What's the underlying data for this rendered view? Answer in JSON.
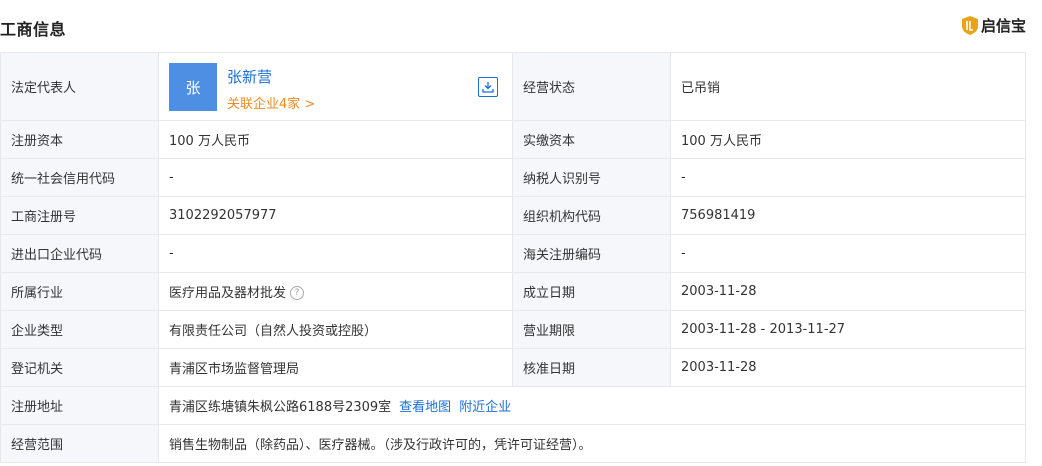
{
  "header": {
    "title": "工商信息",
    "brand": "启信宝",
    "brand_color": "#e8a317"
  },
  "representative": {
    "label": "法定代表人",
    "avatar_char": "张",
    "name": "张新营",
    "related": "关联企业4家 >",
    "download_icon": "download-icon"
  },
  "status": {
    "label": "经营状态",
    "value": "已吊销"
  },
  "rows": [
    {
      "l1": "注册资本",
      "v1": "100 万人民币",
      "l2": "实缴资本",
      "v2": "100 万人民币"
    },
    {
      "l1": "统一社会信用代码",
      "v1": "-",
      "l2": "纳税人识别号",
      "v2": "-"
    },
    {
      "l1": "工商注册号",
      "v1": "3102292057977",
      "l2": "组织机构代码",
      "v2": "756981419"
    },
    {
      "l1": "进出口企业代码",
      "v1": "-",
      "l2": "海关注册编码",
      "v2": "-"
    },
    {
      "l1": "所属行业",
      "v1": "医疗用品及器材批发",
      "l2": "成立日期",
      "v2": "2003-11-28"
    },
    {
      "l1": "企业类型",
      "v1": "有限责任公司（自然人投资或控股）",
      "l2": "营业期限",
      "v2": "2003-11-28 - 2013-11-27"
    },
    {
      "l1": "登记机关",
      "v1": "青浦区市场监督管理局",
      "l2": "核准日期",
      "v2": "2003-11-28"
    }
  ],
  "address": {
    "label": "注册地址",
    "value": "青浦区练塘镇朱枫公路6188号2309室",
    "map_link": "查看地图",
    "nearby_link": "附近企业"
  },
  "scope": {
    "label": "经营范围",
    "value": "销售生物制品（除药品）、医疗器械。（涉及行政许可的，凭许可证经营）。"
  },
  "help_icon_glyph": "?"
}
